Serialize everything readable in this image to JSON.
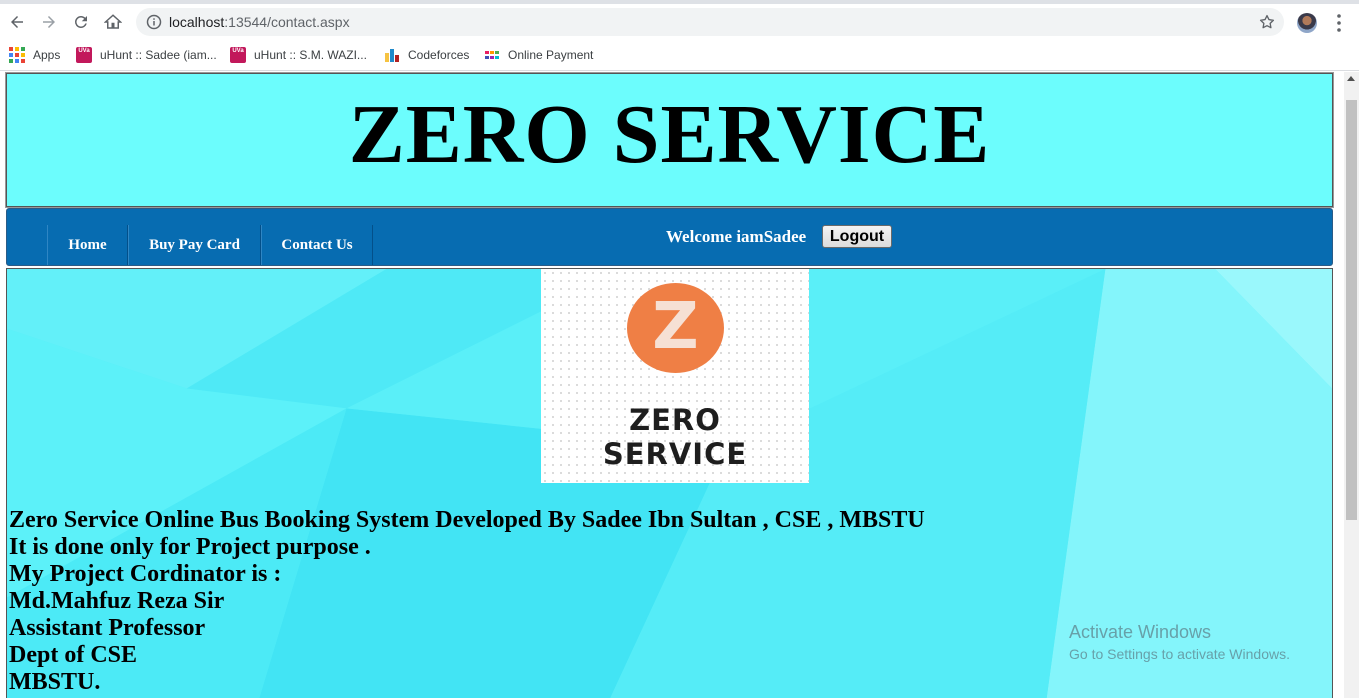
{
  "browser": {
    "url_host": "localhost",
    "url_rest": ":13544/contact.aspx",
    "bookmarks": [
      {
        "label": "Apps",
        "icon": "apps-grid-icon"
      },
      {
        "label": "uHunt :: Sadee (iam...",
        "icon": "uva-icon"
      },
      {
        "label": "uHunt :: S.M. WAZI...",
        "icon": "uva-icon"
      },
      {
        "label": "Codeforces",
        "icon": "codeforces-icon"
      },
      {
        "label": "Online Payment",
        "icon": "payment-icon"
      }
    ]
  },
  "site": {
    "title": "ZERO SERVICE",
    "colors": {
      "header_bg": "#6cfdfd",
      "nav_bg": "#076cb1",
      "content_bg": "#53eef8",
      "logo_orange": "#ef7f45"
    }
  },
  "nav": {
    "items": [
      "Home",
      "Buy Pay Card",
      "Contact Us"
    ],
    "welcome": "Welcome iamSadee",
    "logout_label": "Logout"
  },
  "logo": {
    "letter": "Z",
    "line1": "ZERO",
    "line2": "SERVICE"
  },
  "content": {
    "lines": [
      "Zero Service Online Bus Booking System Developed By Sadee Ibn Sultan , CSE , MBSTU",
      "It is done only for Project purpose .",
      "My Project Cordinator is :",
      "Md.Mahfuz Reza Sir",
      "Assistant Professor",
      "Dept of CSE",
      "MBSTU."
    ]
  },
  "watermark": {
    "line1": "Activate Windows",
    "line2": "Go to Settings to activate Windows."
  }
}
